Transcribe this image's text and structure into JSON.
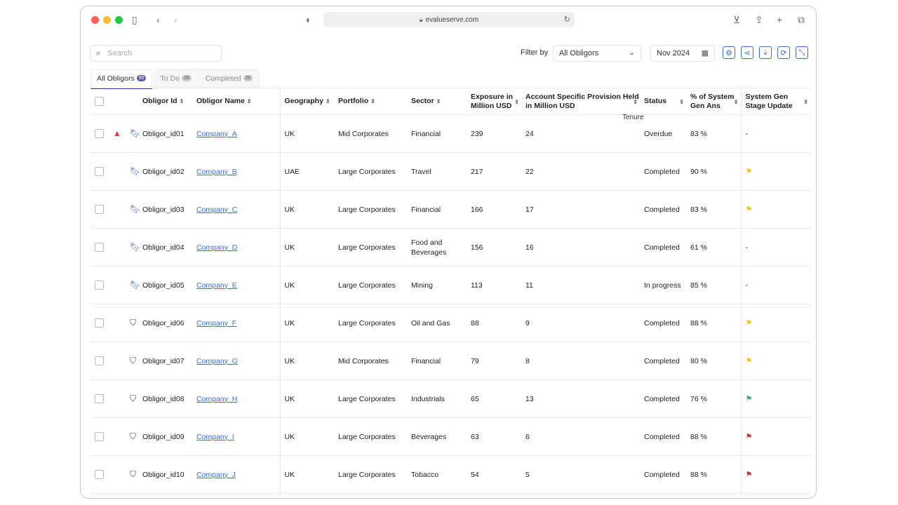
{
  "browser": {
    "url": "evalueserve.com"
  },
  "toolbar": {
    "search_placeholder": "Search",
    "filter_label": "Filter by",
    "filter_value": "All Obligors",
    "date_value": "Nov 2024"
  },
  "tabs": [
    {
      "label": "All Obligors",
      "count": "90"
    },
    {
      "label": "To Do",
      "count": "28"
    },
    {
      "label": "Completed",
      "count": "26"
    }
  ],
  "table": {
    "headers": {
      "obligor_id": "Obligor Id",
      "obligor_name": "Obligor Name",
      "geography": "Geography",
      "portfolio": "Portfolio",
      "sector": "Sector",
      "exposure_1": "Exposure in",
      "exposure_2": "Million USD",
      "provision_1": "Account Specific Provision Held",
      "provision_2": "in Million USD",
      "tenure": "Tenure",
      "status": "Status",
      "pct_1": "% of System",
      "pct_2": "Gen Ans",
      "stage_1": "System Gen",
      "stage_2": "Stage Update"
    },
    "rows": [
      {
        "id": "Obligor_id01",
        "name": "Company_A",
        "geo": "UK",
        "portfolio": "Mid Corporates",
        "sector": "Financial",
        "exposure": "239",
        "provision": "24",
        "status": "Overdue",
        "pct": "83 %",
        "stage": "-",
        "bookmarked": true,
        "warning": true,
        "flag_color": ""
      },
      {
        "id": "Obligor_id02",
        "name": "Company_B",
        "geo": "UAE",
        "portfolio": "Large Corporates",
        "sector": "Travel",
        "exposure": "217",
        "provision": "22",
        "status": "Completed",
        "pct": "90 %",
        "stage": "",
        "bookmarked": true,
        "warning": false,
        "flag_color": "#f5c518"
      },
      {
        "id": "Obligor_id03",
        "name": "Company_C",
        "geo": "UK",
        "portfolio": "Large Corporates",
        "sector": "Financial",
        "exposure": "166",
        "provision": "17",
        "status": "Completed",
        "pct": "83 %",
        "stage": "",
        "bookmarked": true,
        "warning": false,
        "flag_color": "#f5c518"
      },
      {
        "id": "Obligor_id04",
        "name": "Company_D",
        "geo": "UK",
        "portfolio": "Large Corporates",
        "sector": "Food and Beverages",
        "exposure": "156",
        "provision": "16",
        "status": "Completed",
        "pct": "61 %",
        "stage": "-",
        "bookmarked": true,
        "warning": false,
        "flag_color": ""
      },
      {
        "id": "Obligor_id05",
        "name": "Company_E",
        "geo": "UK",
        "portfolio": "Large Corporates",
        "sector": "Mining",
        "exposure": "113",
        "provision": "11",
        "status": "In progress",
        "pct": "85 %",
        "stage": "-",
        "bookmarked": true,
        "warning": false,
        "flag_color": ""
      },
      {
        "id": "Obligor_id06",
        "name": "Company_F",
        "geo": "UK",
        "portfolio": "Large Corporates",
        "sector": "Oil and Gas",
        "exposure": "88",
        "provision": "9",
        "status": "Completed",
        "pct": "88 %",
        "stage": "",
        "bookmarked": false,
        "warning": false,
        "flag_color": "#f5c518"
      },
      {
        "id": "Obligor_id07",
        "name": "Company_G",
        "geo": "UK",
        "portfolio": "Mid Corporates",
        "sector": "Financial",
        "exposure": "79",
        "provision": "8",
        "status": "Completed",
        "pct": "80 %",
        "stage": "",
        "bookmarked": false,
        "warning": false,
        "flag_color": "#f5c518"
      },
      {
        "id": "Obligor_id08",
        "name": "Company_H",
        "geo": "UK",
        "portfolio": "Large Corporates",
        "sector": "Industrials",
        "exposure": "65",
        "provision": "13",
        "status": "Completed",
        "pct": "76 %",
        "stage": "",
        "bookmarked": false,
        "warning": false,
        "flag_color": "#3aa58a"
      },
      {
        "id": "Obligor_id09",
        "name": "Company_I",
        "geo": "UK",
        "portfolio": "Large Corporates",
        "sector": "Beverages",
        "exposure": "63",
        "provision": "6",
        "status": "Completed",
        "pct": "88 %",
        "stage": "",
        "bookmarked": false,
        "warning": false,
        "flag_color": "#c8323c"
      },
      {
        "id": "Obligor_id10",
        "name": "Company_J",
        "geo": "UK",
        "portfolio": "Large Corporates",
        "sector": "Tobacco",
        "exposure": "54",
        "provision": "5",
        "status": "Completed",
        "pct": "88 %",
        "stage": "",
        "bookmarked": false,
        "warning": false,
        "flag_color": "#c8323c"
      }
    ]
  },
  "colors": {
    "accent": "#3a6fd8",
    "bookmark": "#2e5cc4",
    "warning": "#e53935",
    "tab_underline": "#3a3a8c"
  },
  "icons": [
    "sidebar-icon",
    "back-icon",
    "forward-icon",
    "shield-icon",
    "lock-icon",
    "reload-icon",
    "download-icon",
    "share-icon",
    "new-tab-icon",
    "tabs-icon",
    "search-icon",
    "chevron-down-icon",
    "calendar-icon",
    "settings-icon",
    "share-network-icon",
    "download-box-icon",
    "refresh-icon",
    "collapse-icon",
    "bookmark-icon",
    "warning-icon",
    "flag-icon",
    "sort-icon"
  ]
}
